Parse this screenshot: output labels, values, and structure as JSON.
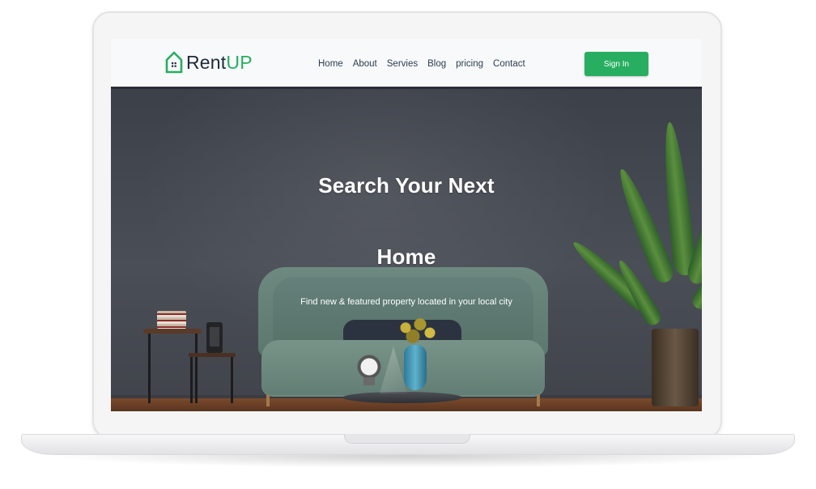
{
  "brand": {
    "rent": "Rent",
    "up": "UP",
    "icon": "house-icon",
    "accent_color": "#27ae60",
    "dark_color": "#1d2b3a"
  },
  "nav": {
    "items": [
      {
        "label": "Home"
      },
      {
        "label": "About"
      },
      {
        "label": "Servies"
      },
      {
        "label": "Blog"
      },
      {
        "label": "pricing"
      },
      {
        "label": "Contact"
      }
    ],
    "signin_label": "Sign In"
  },
  "hero": {
    "title_line1": "Search Your Next",
    "title_line2": "Home",
    "subtitle": "Find new & featured property located in your local city"
  },
  "colors": {
    "button": "#27ae60",
    "hero_text": "#ffffff"
  }
}
